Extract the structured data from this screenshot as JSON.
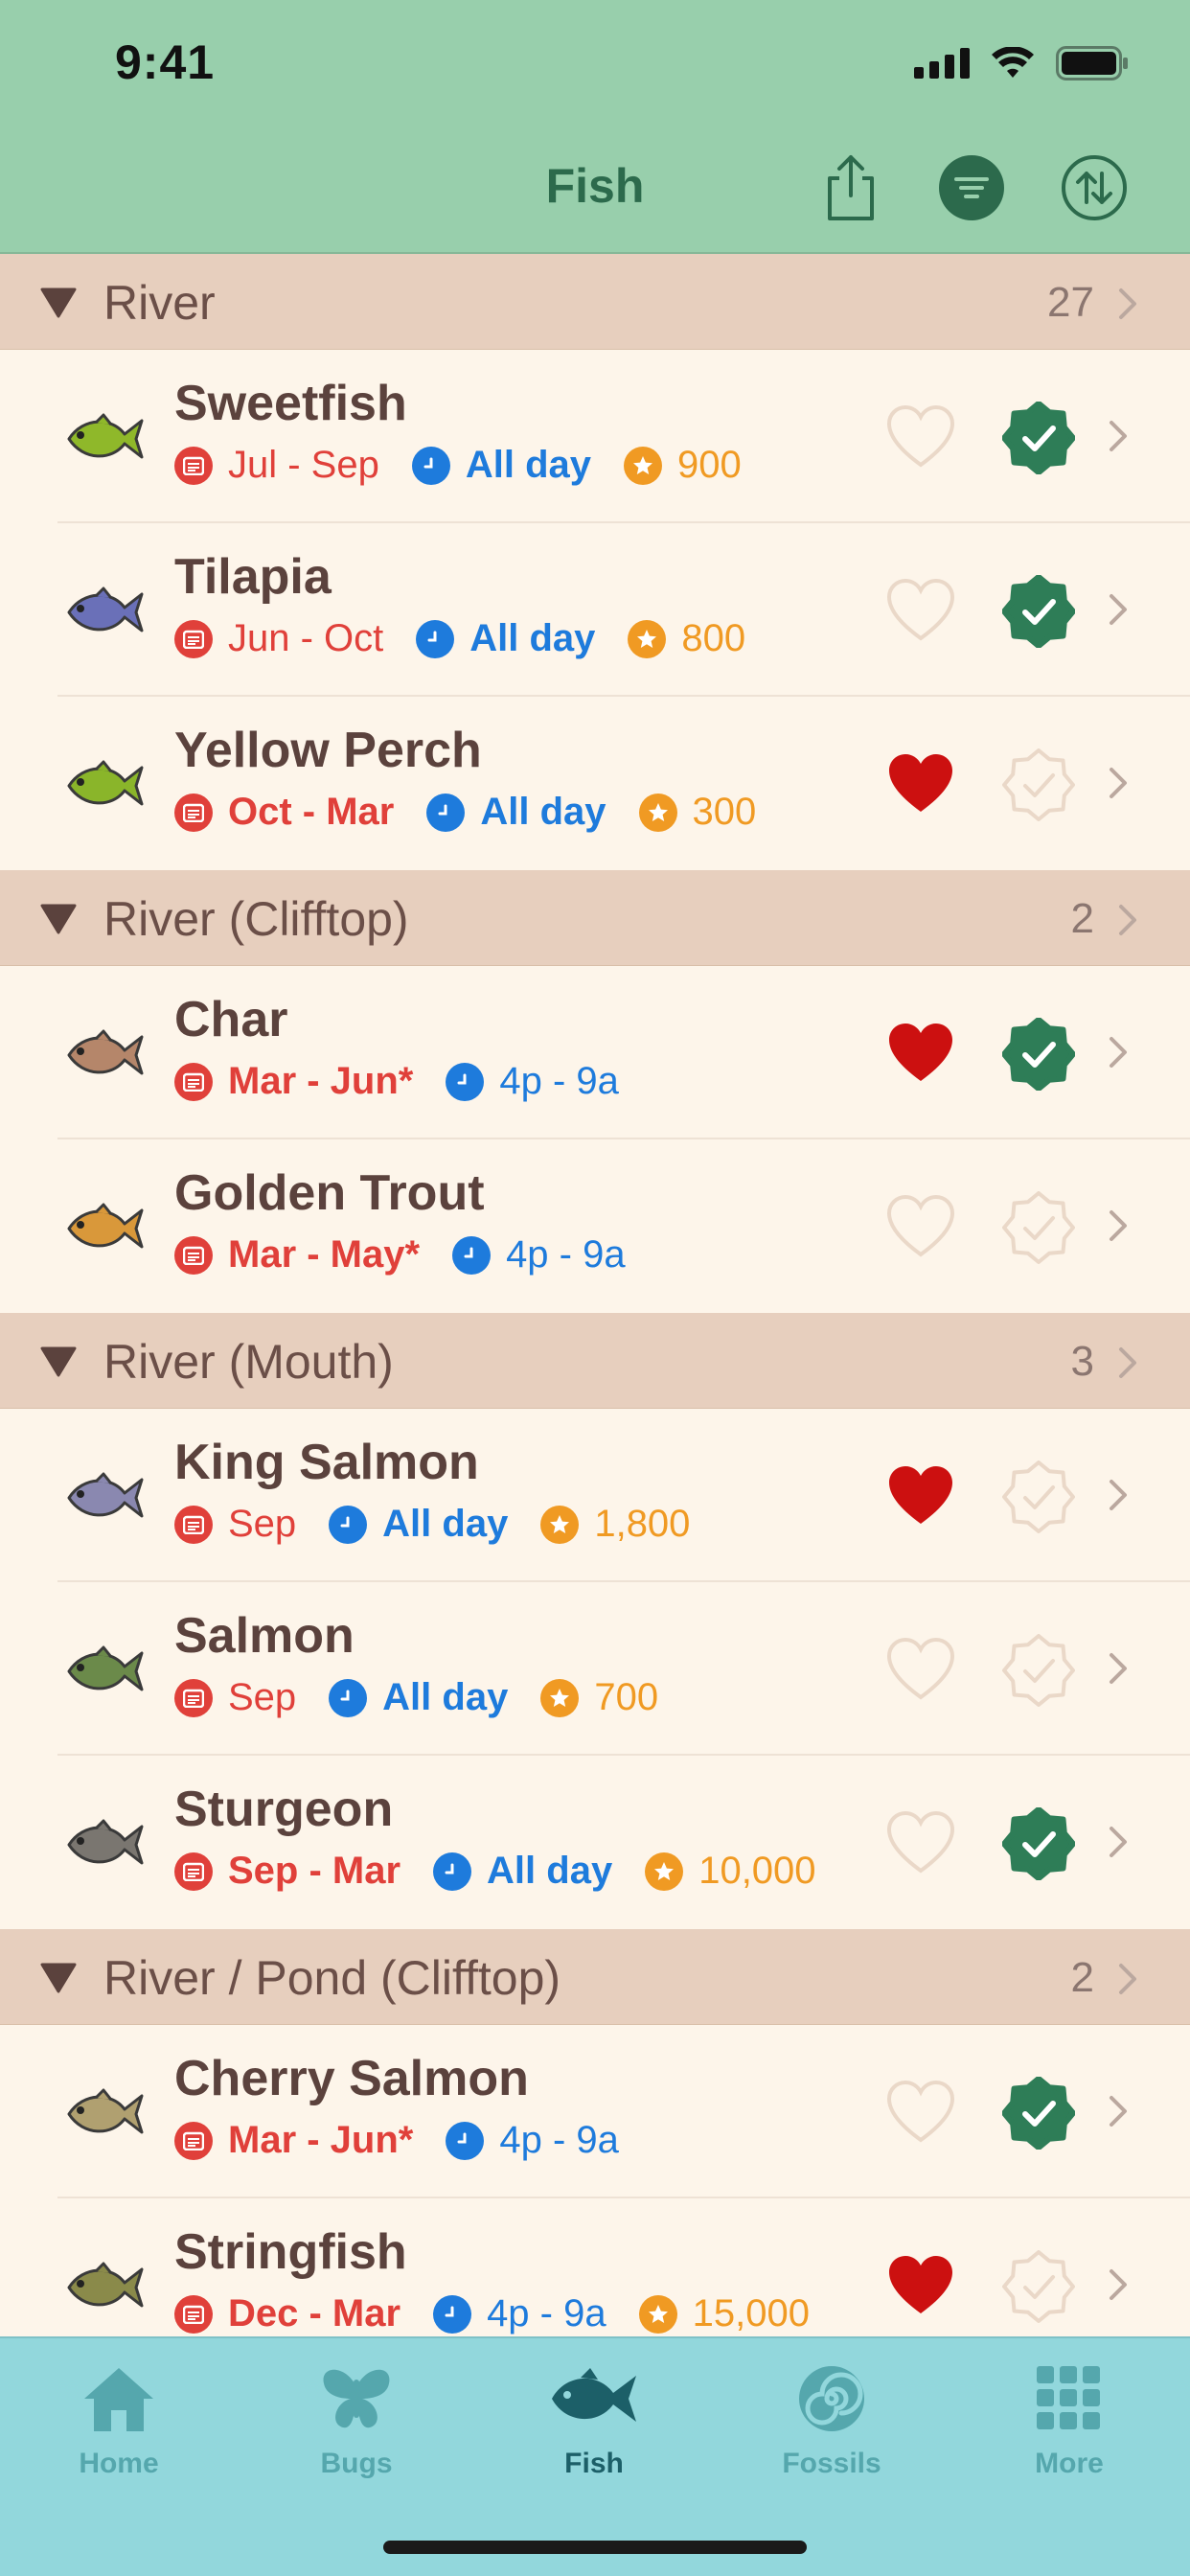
{
  "status": {
    "time": "9:41"
  },
  "nav": {
    "title": "Fish"
  },
  "sections": [
    {
      "title": "River",
      "count": "27",
      "items": [
        {
          "name": "Sweetfish",
          "months": "Jul - Sep",
          "months_bold": false,
          "hours": "All day",
          "hours_bold": true,
          "price": "900",
          "favorite": false,
          "caught": true,
          "color": "#8fb82a"
        },
        {
          "name": "Tilapia",
          "months": "Jun - Oct",
          "months_bold": false,
          "hours": "All day",
          "hours_bold": true,
          "price": "800",
          "favorite": false,
          "caught": true,
          "color": "#6a70b8"
        },
        {
          "name": "Yellow Perch",
          "months": "Oct - Mar",
          "months_bold": true,
          "hours": "All day",
          "hours_bold": true,
          "price": "300",
          "favorite": true,
          "caught": false,
          "color": "#8ab52a"
        }
      ]
    },
    {
      "title": "River (Clifftop)",
      "count": "2",
      "items": [
        {
          "name": "Char",
          "months": "Mar - Jun*",
          "months_bold": true,
          "hours": "4p - 9a",
          "hours_bold": false,
          "price": "",
          "favorite": true,
          "caught": true,
          "color": "#b5866a"
        },
        {
          "name": "Golden Trout",
          "months": "Mar - May*",
          "months_bold": true,
          "hours": "4p - 9a",
          "hours_bold": false,
          "price": "",
          "favorite": false,
          "caught": false,
          "color": "#d9983a"
        }
      ]
    },
    {
      "title": "River (Mouth)",
      "count": "3",
      "items": [
        {
          "name": "King Salmon",
          "months": "Sep",
          "months_bold": false,
          "hours": "All day",
          "hours_bold": true,
          "price": "1,800",
          "favorite": true,
          "caught": false,
          "color": "#8a88b0"
        },
        {
          "name": "Salmon",
          "months": "Sep",
          "months_bold": false,
          "hours": "All day",
          "hours_bold": true,
          "price": "700",
          "favorite": false,
          "caught": false,
          "color": "#6b8a4a"
        },
        {
          "name": "Sturgeon",
          "months": "Sep - Mar",
          "months_bold": true,
          "hours": "All day",
          "hours_bold": true,
          "price": "10,000",
          "favorite": false,
          "caught": true,
          "color": "#7a7670"
        }
      ]
    },
    {
      "title": "River / Pond (Clifftop)",
      "count": "2",
      "items": [
        {
          "name": "Cherry Salmon",
          "months": "Mar - Jun*",
          "months_bold": true,
          "hours": "4p - 9a",
          "hours_bold": false,
          "price": "",
          "favorite": false,
          "caught": true,
          "color": "#b0a070"
        },
        {
          "name": "Stringfish",
          "months": "Dec - Mar",
          "months_bold": true,
          "hours": "4p - 9a",
          "hours_bold": false,
          "price": "15,000",
          "favorite": true,
          "caught": false,
          "color": "#8a8a4a"
        }
      ]
    }
  ],
  "tabs": [
    {
      "label": "Home",
      "icon": "home-icon",
      "active": false
    },
    {
      "label": "Bugs",
      "icon": "butterfly-icon",
      "active": false
    },
    {
      "label": "Fish",
      "icon": "fish-icon",
      "active": true
    },
    {
      "label": "Fossils",
      "icon": "fossil-icon",
      "active": false
    },
    {
      "label": "More",
      "icon": "grid-icon",
      "active": false
    }
  ],
  "colors": {
    "nav_bg": "#98cfac",
    "section_bg": "#e7cfbe",
    "row_bg": "#fdf5ea",
    "month_red": "#e0403a",
    "hours_blue": "#1e7bdc",
    "price_orange": "#f09a23",
    "heart_red": "#cc1010",
    "check_green": "#2e7d57",
    "tab_bg": "#92d7dc"
  }
}
